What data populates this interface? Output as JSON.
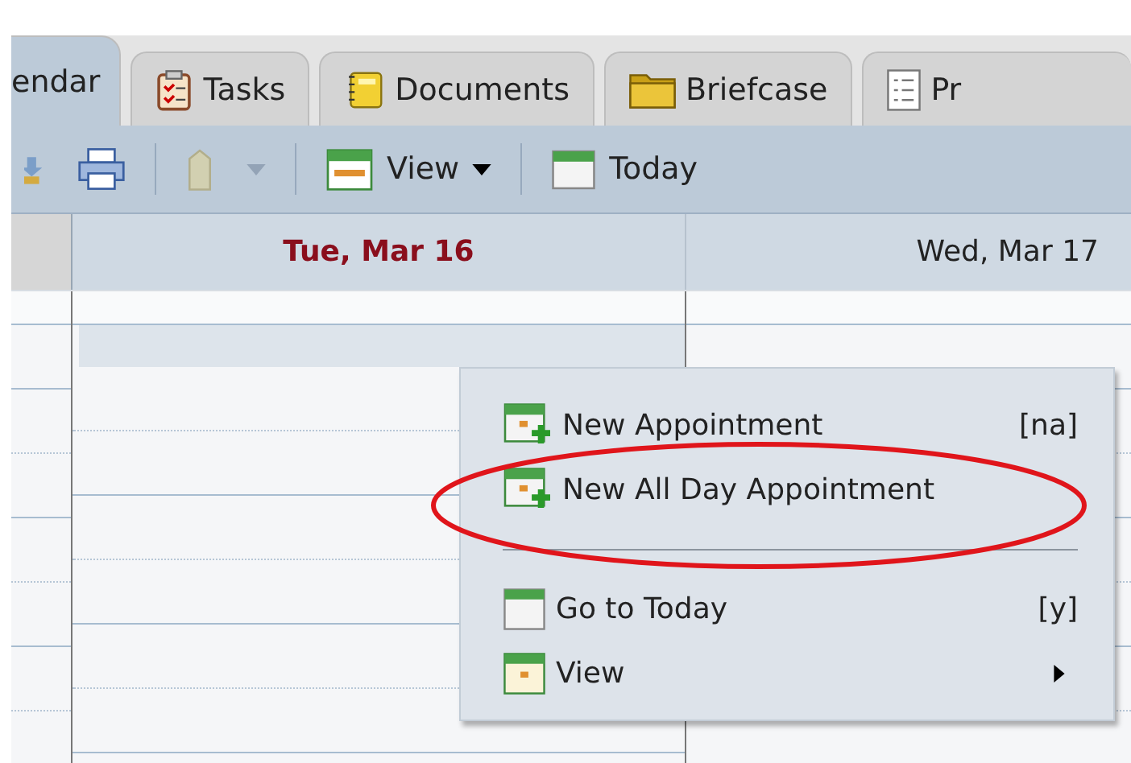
{
  "tabs": [
    {
      "label": "endar",
      "kind": "none",
      "selected": true
    },
    {
      "label": "Tasks",
      "kind": "tasks",
      "selected": false
    },
    {
      "label": "Documents",
      "kind": "notebook",
      "selected": false
    },
    {
      "label": "Briefcase",
      "kind": "folder",
      "selected": false
    },
    {
      "label": "Pr",
      "kind": "list",
      "selected": false
    }
  ],
  "toolbar": [
    {
      "kind": "download"
    },
    {
      "kind": "printer"
    },
    {
      "kind": "separator"
    },
    {
      "kind": "tag",
      "disabled": true
    },
    {
      "kind": "caret",
      "disabled": true
    },
    {
      "kind": "separator"
    },
    {
      "kind": "view",
      "label": "View"
    },
    {
      "kind": "separator"
    },
    {
      "kind": "today",
      "label": "Today"
    }
  ],
  "day_headers": [
    {
      "label": "Tue, Mar 16",
      "today": true
    },
    {
      "label": "Wed, Mar 17",
      "today": false
    }
  ],
  "context_menu": [
    {
      "kind": "new",
      "label": "New Appointment",
      "shortcut": "[na]",
      "circled": false
    },
    {
      "kind": "new",
      "label": "New All Day Appointment",
      "circled": true
    },
    {
      "kind": "separator"
    },
    {
      "kind": "today",
      "label": "Go to Today",
      "shortcut": "[y]",
      "circled": false
    },
    {
      "kind": "submenu",
      "label": "View",
      "circled": false
    }
  ]
}
